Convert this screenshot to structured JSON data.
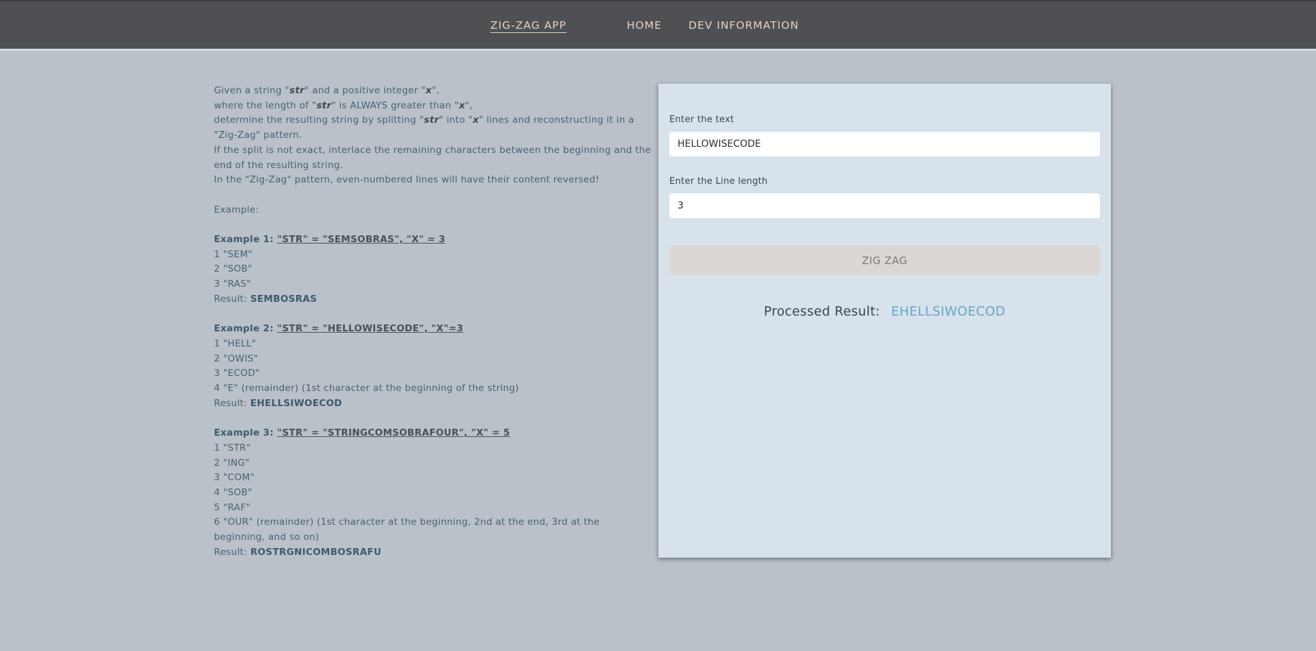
{
  "nav": {
    "brand": "ZIG-ZAG APP",
    "home": "HOME",
    "dev": "DEV INFORMATION"
  },
  "description": {
    "p1_a": "Given a string \"",
    "p1_str": "str",
    "p1_b": "\" and a positive integer \"",
    "p1_x": "x",
    "p1_c": "\",",
    "p2_a": "where the length of \"",
    "p2_str": "str",
    "p2_b": "\" is ALWAYS greater than \"",
    "p2_x": "x",
    "p2_c": "\",",
    "p3_a": "determine the resulting string by splitting \"",
    "p3_str": "str",
    "p3_b": "\" into \"",
    "p3_x": "x",
    "p3_c": "\" lines and reconstructing it in a \"Zig-Zag\" pattern.",
    "p4": "If the split is not exact, interlace the remaining characters between the beginning and the end of the resulting string.",
    "p5": "In the \"Zig-Zag\" pattern, even-numbered lines will have their content reversed!",
    "example_heading": "Example:",
    "result_prefix": "Result: "
  },
  "examples": [
    {
      "label": "Example 1: ",
      "spec": "\"STR\" = \"SEMSOBRAS\", \"X\" = 3",
      "lines": [
        "1 \"SEM\"",
        "2 \"SOB\"",
        "3 \"RAS\""
      ],
      "result": "SEMBOSRAS"
    },
    {
      "label": "Example 2: ",
      "spec": "\"STR\" = \"HELLOWISECODE\", \"X\"=3",
      "lines": [
        "1 \"HELL\"",
        "2 \"OWIS\"",
        "3 \"ECOD\"",
        "4 \"E\" (remainder) (1st character at the beginning of the string)"
      ],
      "result": "EHELLSIWOECOD"
    },
    {
      "label": "Example 3: ",
      "spec": "\"STR\" = \"STRINGCOMSOBRAFOUR\", \"X\" = 5",
      "lines": [
        "1 \"STR\"",
        "2 \"ING\"",
        "3 \"COM\"",
        "4 \"SOB\"",
        "5 \"RAF\"",
        "6 \"OUR\" (remainder) (1st character at the beginning, 2nd at the end, 3rd at the beginning, and so on)"
      ],
      "result": "ROSTRGNICOMBOSRAFU"
    }
  ],
  "form": {
    "text_label": "Enter the text",
    "text_value": "HELLOWISECODE",
    "length_label": "Enter the Line length",
    "length_value": "3",
    "button_label": "ZIG ZAG",
    "result_label": "Processed Result:",
    "result_value": "EHELLSIWOECOD"
  }
}
